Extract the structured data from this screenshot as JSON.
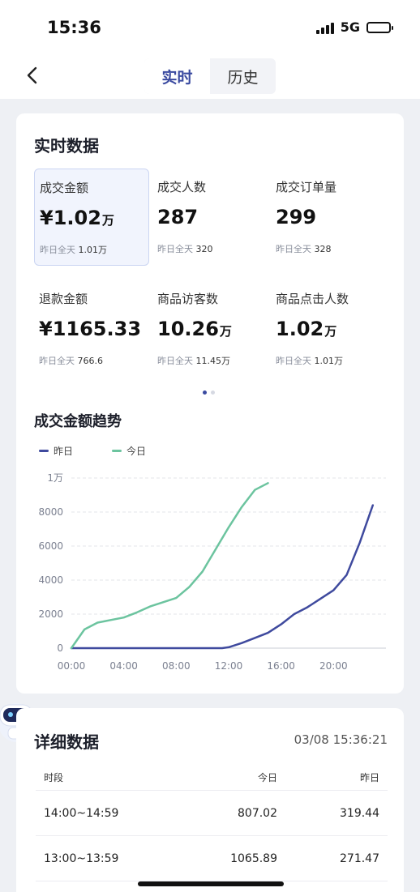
{
  "status_bar": {
    "time": "15:36",
    "network": "5G"
  },
  "nav": {
    "back_icon": "chevron-left-icon",
    "tabs": [
      {
        "label": "实时",
        "active": true
      },
      {
        "label": "历史",
        "active": false
      }
    ]
  },
  "realtime": {
    "title": "实时数据",
    "metrics": [
      {
        "label": "成交金额",
        "value": "¥1.02",
        "unit": "万",
        "sub_label": "昨日全天",
        "sub_value": "1.01万",
        "selected": true
      },
      {
        "label": "成交人数",
        "value": "287",
        "unit": "",
        "sub_label": "昨日全天",
        "sub_value": "320",
        "selected": false
      },
      {
        "label": "成交订单量",
        "value": "299",
        "unit": "",
        "sub_label": "昨日全天",
        "sub_value": "328",
        "selected": false
      },
      {
        "label": "退款金额",
        "value": "¥1165.33",
        "unit": "",
        "sub_label": "昨日全天",
        "sub_value": "766.6",
        "selected": false
      },
      {
        "label": "商品访客数",
        "value": "10.26",
        "unit": "万",
        "sub_label": "昨日全天",
        "sub_value": "11.45万",
        "selected": false
      },
      {
        "label": "商品点击人数",
        "value": "1.02",
        "unit": "万",
        "sub_label": "昨日全天",
        "sub_value": "1.01万",
        "selected": false
      }
    ],
    "pager": {
      "pages": 2,
      "current": 1
    }
  },
  "trend": {
    "title": "成交金额趋势",
    "legend": [
      {
        "name": "昨日",
        "color": "#3f4a9e"
      },
      {
        "name": "今日",
        "color": "#6cc49f"
      }
    ]
  },
  "chart_data": {
    "type": "line",
    "x_ticks": [
      "00:00",
      "04:00",
      "08:00",
      "12:00",
      "16:00",
      "20:00"
    ],
    "y_ticks": [
      "0",
      "2000",
      "4000",
      "6000",
      "8000",
      "1万"
    ],
    "ylim": [
      0,
      10000
    ],
    "xlim": [
      0,
      24
    ],
    "grid": true,
    "legend_position": "top-left",
    "series": [
      {
        "name": "昨日",
        "color": "#3f4a9e",
        "x": [
          0,
          2,
          4,
          6,
          8,
          10,
          11.5,
          12,
          13,
          14,
          15,
          16,
          17,
          18,
          19,
          20,
          21,
          22,
          23
        ],
        "y": [
          0,
          0,
          0,
          0,
          0,
          0,
          0,
          50,
          300,
          600,
          900,
          1400,
          2000,
          2400,
          2900,
          3400,
          4300,
          6200,
          8400
        ]
      },
      {
        "name": "今日",
        "color": "#6cc49f",
        "x": [
          0,
          1,
          2,
          3,
          4,
          5,
          6,
          7,
          8,
          9,
          10,
          11,
          12,
          13,
          14,
          15
        ],
        "y": [
          0,
          1100,
          1500,
          1650,
          1800,
          2100,
          2450,
          2700,
          2950,
          3600,
          4500,
          5800,
          7100,
          8300,
          9300,
          9700
        ]
      }
    ]
  },
  "detail": {
    "title": "详细数据",
    "time": "03/08 15:36:21",
    "headers": [
      "时段",
      "今日",
      "昨日"
    ],
    "rows": [
      {
        "period": "14:00~14:59",
        "today": "807.02",
        "yesterday": "319.44"
      },
      {
        "period": "13:00~13:59",
        "today": "1065.89",
        "yesterday": "271.47"
      }
    ]
  }
}
